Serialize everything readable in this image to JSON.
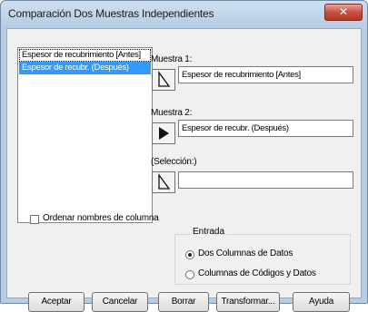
{
  "window": {
    "title": "Comparación Dos Muestras Independientes",
    "close_icon": "close-icon"
  },
  "variables": {
    "items": [
      "Espesor de recubrimiento [Antes]",
      "Espesor de recubr. (Después)"
    ],
    "selected_index": 1
  },
  "muestra1": {
    "label": "Muestra 1:",
    "value": "Espesor de recubrimiento [Antes]"
  },
  "muestra2": {
    "label": "Muestra 2:",
    "value": "Espesor de recubr. (Después)"
  },
  "seleccion": {
    "label": "(Selección:)",
    "value": ""
  },
  "ordenar": {
    "label": "Ordenar nombres de columna",
    "checked": false
  },
  "entrada": {
    "title": "Entrada",
    "options": [
      "Dos Columnas de Datos",
      "Columnas de Códigos y Datos"
    ],
    "selected": "Dos Columnas de Datos"
  },
  "buttons": {
    "aceptar": "Aceptar",
    "cancelar": "Cancelar",
    "borrar": "Borrar",
    "transformar": "Transformar...",
    "ayuda": "Ayuda"
  }
}
